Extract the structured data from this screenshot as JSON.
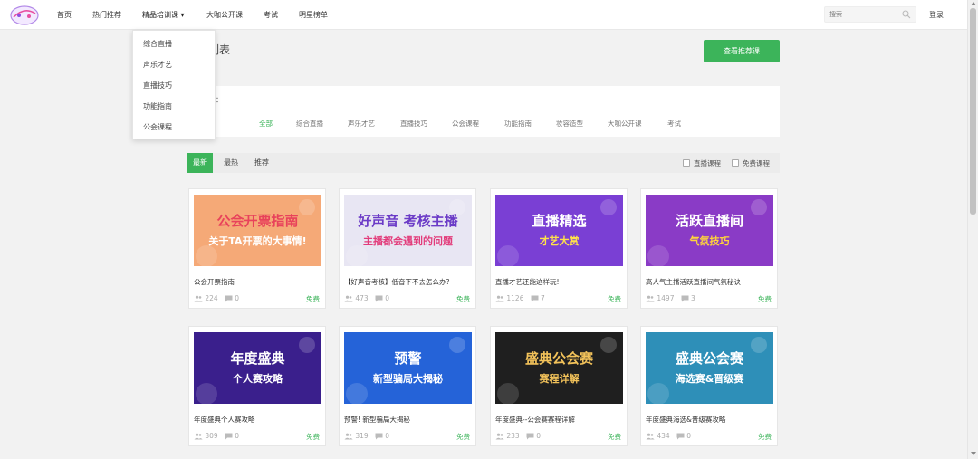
{
  "nav": {
    "items": [
      "首页",
      "热门推荐",
      "精品培训课",
      "大咖公开课",
      "考试",
      "明星榜单"
    ],
    "dropdown_caret": "▾",
    "search_placeholder": "搜索",
    "login": "登录"
  },
  "dropdown": {
    "items": [
      "综合直播",
      "声乐才艺",
      "直播技巧",
      "功能指南",
      "公会课程"
    ]
  },
  "page": {
    "title_fragment": "列表",
    "recommend_button": "查看推荐课"
  },
  "category": {
    "label_fragment": "类：",
    "items": [
      "全部",
      "综合直播",
      "声乐才艺",
      "直播技巧",
      "公会课程",
      "功能指南",
      "妆容造型",
      "大咖公开课",
      "考试"
    ]
  },
  "filter": {
    "tabs": [
      "最新",
      "最热",
      "推荐"
    ],
    "checkboxes": [
      "直播课程",
      "免费课程"
    ]
  },
  "courses": [
    {
      "title": "公会开票指南",
      "views": "224",
      "comments": "0",
      "price": "免费",
      "thumb": {
        "bg": "#f5a977",
        "line1": "公会开票指南",
        "line2": "关于TA开票的大事情!",
        "c1": "#e8425b",
        "c2": "#ffffff"
      }
    },
    {
      "title": "【好声音考核】低音下不去怎么办?",
      "views": "473",
      "comments": "0",
      "price": "免费",
      "thumb": {
        "bg": "#e8e6f3",
        "line1": "好声音 考核主播",
        "line2": "主播都会遇到的问题",
        "c1": "#6b3bc7",
        "c2": "#e23b7a"
      }
    },
    {
      "title": "直播才艺还能这样玩!",
      "views": "1126",
      "comments": "7",
      "price": "免费",
      "thumb": {
        "bg": "#7a3fd4",
        "line1": "直播精选",
        "line2": "才艺大赏",
        "c1": "#ffffff",
        "c2": "#ffe14a"
      }
    },
    {
      "title": "高人气主播活跃直播间气氛秘诀",
      "views": "1497",
      "comments": "3",
      "price": "免费",
      "thumb": {
        "bg": "#8a3bc6",
        "line1": "活跃直播间",
        "line2": "气氛技巧",
        "c1": "#ffffff",
        "c2": "#ffd43b"
      }
    },
    {
      "title": "年度盛典个人赛攻略",
      "views": "309",
      "comments": "0",
      "price": "免费",
      "thumb": {
        "bg": "#3a1f8c",
        "line1": "年度盛典",
        "line2": "个人赛攻略",
        "c1": "#ffffff",
        "c2": "#ffffff"
      }
    },
    {
      "title": "预警! 新型骗局大揭秘",
      "views": "319",
      "comments": "0",
      "price": "免费",
      "thumb": {
        "bg": "#2563d8",
        "line1": "预警",
        "line2": "新型骗局大揭秘",
        "c1": "#ffffff",
        "c2": "#ffffff"
      }
    },
    {
      "title": "年度盛典--公会赛赛程详解",
      "views": "233",
      "comments": "0",
      "price": "免费",
      "thumb": {
        "bg": "#1f1f1f",
        "line1": "盛典公会赛",
        "line2": "赛程详解",
        "c1": "#f2c25a",
        "c2": "#f2c25a"
      }
    },
    {
      "title": "年度盛典海选&晋级赛攻略",
      "views": "434",
      "comments": "0",
      "price": "免费",
      "thumb": {
        "bg": "#2e8fb8",
        "line1": "盛典公会赛",
        "line2": "海选赛&晋级赛",
        "c1": "#ffffff",
        "c2": "#ffffff"
      }
    }
  ],
  "colors": {
    "accent": "#3cb45a",
    "text": "#333333",
    "muted": "#aaaaaa"
  }
}
